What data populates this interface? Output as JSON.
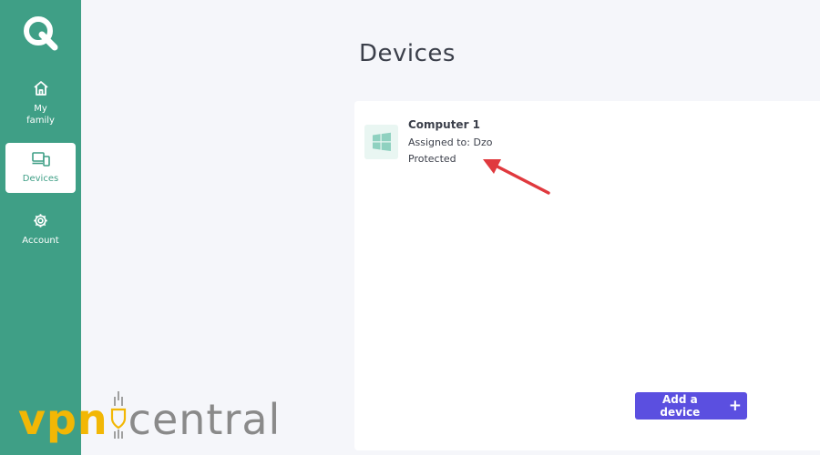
{
  "sidebar": {
    "logo_icon": "q-logo-icon",
    "items": [
      {
        "label": "My family",
        "icon": "home-icon",
        "active": false
      },
      {
        "label": "Devices",
        "icon": "devices-icon",
        "active": true
      },
      {
        "label": "Account",
        "icon": "gear-icon",
        "active": false
      }
    ]
  },
  "main": {
    "title": "Devices",
    "devices": [
      {
        "name": "Computer 1",
        "assigned": "Assigned to: Dzo",
        "status": "Protected",
        "icon": "windows-icon"
      }
    ],
    "add_button_label": "Add a device",
    "add_button_icon": "plus-icon"
  },
  "annotation": {
    "icon": "red-arrow-icon",
    "color": "#e0393e"
  },
  "watermark": {
    "vpn": "vpn",
    "central": "central"
  },
  "colors": {
    "sidebar": "#3f9f86",
    "accent_button": "#5b4fe0",
    "background": "#f5f6fa",
    "watermark_yellow": "#f2b705"
  }
}
